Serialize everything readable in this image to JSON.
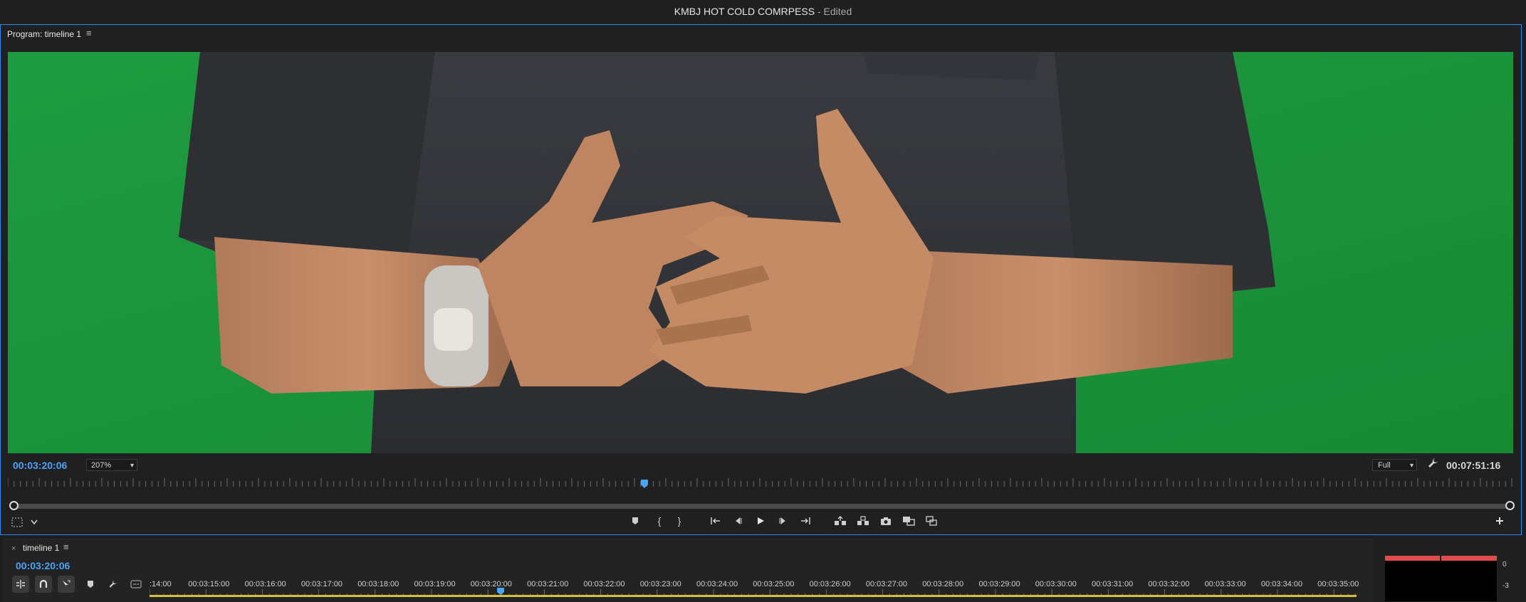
{
  "app": {
    "title": "KMBJ HOT COLD COMRPESS",
    "title_status": "- Edited"
  },
  "program_monitor": {
    "tab_label": "Program: timeline 1",
    "menu_icon": "hamburger-menu-icon",
    "current_timecode": "00:03:20:06",
    "zoom_level": "207%",
    "playback_resolution": "Full",
    "duration_timecode": "00:07:51:16",
    "controls": [
      {
        "name": "add-marker-button",
        "icon": "marker-icon"
      },
      {
        "name": "mark-in-button",
        "icon": "mark-in-icon"
      },
      {
        "name": "mark-out-button",
        "icon": "mark-out-icon"
      },
      {
        "name": "go-to-in-button",
        "icon": "go-to-in-icon"
      },
      {
        "name": "step-back-button",
        "icon": "step-back-icon"
      },
      {
        "name": "play-button",
        "icon": "play-icon"
      },
      {
        "name": "step-forward-button",
        "icon": "step-forward-icon"
      },
      {
        "name": "go-to-out-button",
        "icon": "go-to-out-icon"
      },
      {
        "name": "lift-button",
        "icon": "lift-icon"
      },
      {
        "name": "extract-button",
        "icon": "extract-icon"
      },
      {
        "name": "export-frame-button",
        "icon": "camera-icon"
      },
      {
        "name": "comparison-view-button",
        "icon": "comparison-icon"
      },
      {
        "name": "multicam-button",
        "icon": "multicam-icon"
      }
    ],
    "accent_color": "#4aa3ff",
    "video_background_color": "#1d9a42"
  },
  "timeline": {
    "tab_label": "timeline 1",
    "current_timecode": "00:03:20:06",
    "ruler_labels": [
      ":14:00",
      "00:03:15:00",
      "00:03:16:00",
      "00:03:17:00",
      "00:03:18:00",
      "00:03:19:00",
      "00:03:20:00",
      "00:03:21:00",
      "00:03:22:00",
      "00:03:23:00",
      "00:03:24:00",
      "00:03:25:00",
      "00:03:26:00",
      "00:03:27:00",
      "00:03:28:00",
      "00:03:29:00",
      "00:03:30:00",
      "00:03:31:00",
      "00:03:32:00",
      "00:03:33:00",
      "00:03:34:00",
      "00:03:35:00"
    ],
    "tools": [
      "insert-overwrite-icon",
      "snap-magnet-icon",
      "linked-selection-icon",
      "marker-icon",
      "wrench-icon",
      "captions-icon"
    ]
  },
  "audio_meter": {
    "labels": [
      "0",
      "-3"
    ],
    "peak_color": "#e04b4b"
  }
}
